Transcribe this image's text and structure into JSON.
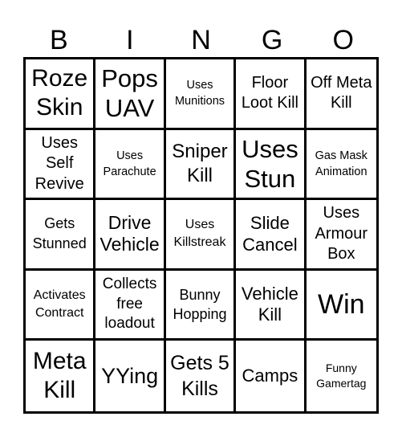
{
  "header": {
    "letters": [
      "B",
      "I",
      "N",
      "G",
      "O"
    ]
  },
  "cells": [
    [
      "Roze Skin",
      "Pops UAV",
      "Uses Munitions",
      "Floor Loot Kill",
      "Off Meta Kill"
    ],
    [
      "Uses Self Revive",
      "Uses Parachute",
      "Sniper Kill",
      "Uses Stun",
      "Gas Mask Animation"
    ],
    [
      "Gets Stunned",
      "Drive Vehicle",
      "Uses Killstreak",
      "Slide Cancel",
      "Uses Armour Box"
    ],
    [
      "Activates Contract",
      "Collects free loadout",
      "Bunny Hopping",
      "Vehicle Kill",
      "Win"
    ],
    [
      "Meta Kill",
      "YYing",
      "Gets 5 Kills",
      "Camps",
      "Funny Gamertag"
    ]
  ]
}
